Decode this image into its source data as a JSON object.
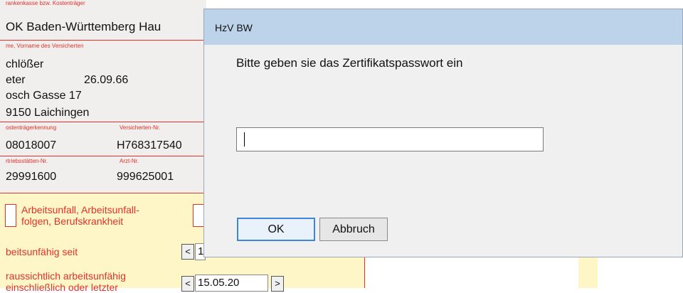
{
  "background_form": {
    "insurer_label": "rankenkasse bzw. Kostenträger",
    "insurer_value": "OK Baden-Württemberg Hau",
    "name_label": "me, Vorname des Versicherten",
    "surname": "chlößer",
    "firstname": "eter",
    "birthdate": "26.09.66",
    "street": "osch Gasse 17",
    "city": "9150 Laichingen",
    "payer_id_label": "ostenträgerkennung",
    "insured_no_label": "Versicherten-Nr.",
    "payer_id_value": "08018007",
    "insured_no_value": "H768317540",
    "site_no_label": "rtriebsstätten-Nr.",
    "doctor_no_label": "Arzt-Nr.",
    "site_no_value": "29991600",
    "doctor_no_value": "999625001",
    "accident_label_line1": "Arbeitsunfall, Arbeitsunfall-",
    "accident_label_line2": "folgen, Berufskrankheit",
    "unfit_since_label": "beitsunfähig seit",
    "expected_unfit_line1": "raussichtlich arbeitsunfähig",
    "expected_unfit_line2": "einschließlich oder letzter",
    "prev_button": "<",
    "next_button": ">",
    "unfit_since_value": "1",
    "expected_date_value": "15.05.20"
  },
  "dialog": {
    "title": "HzV BW",
    "prompt": "Bitte geben sie das Zertifikatspasswort ein",
    "password_value": "",
    "ok_label": "OK",
    "cancel_label": "Abbruch"
  },
  "colors": {
    "form_red": "#e0322a",
    "titlebar": "#bdd3ea",
    "form_yellow": "#fff6c8",
    "ok_border": "#3e86d6"
  }
}
